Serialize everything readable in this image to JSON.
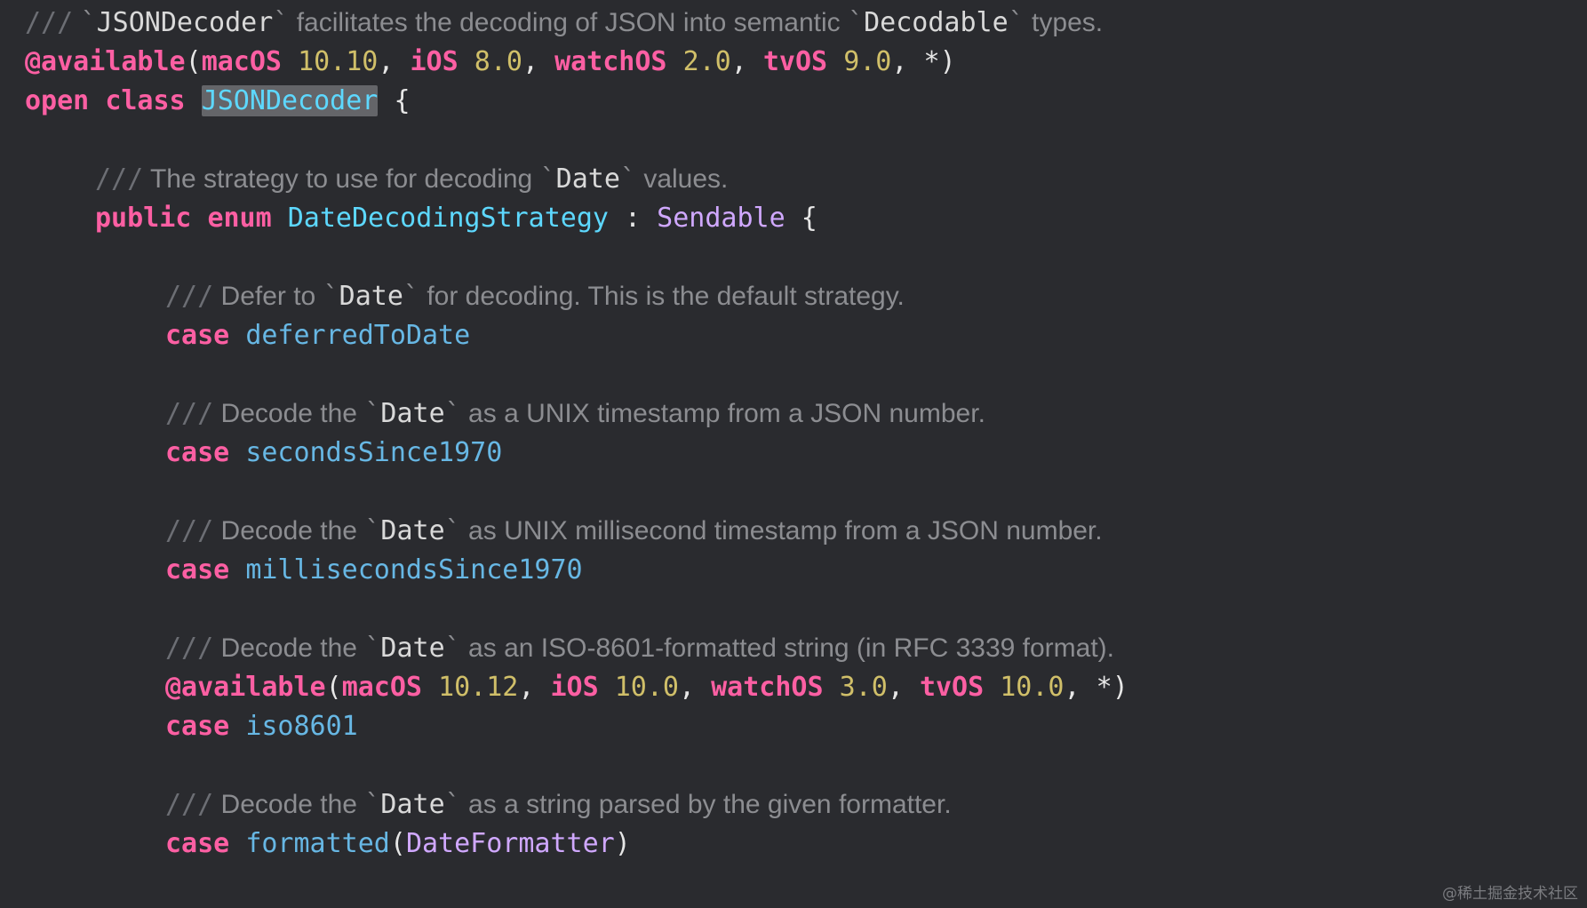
{
  "code": {
    "decoder_doc": {
      "slashes": "///",
      "code1": "JSONDecoder",
      "text1": "facilitates the decoding of JSON into semantic",
      "code2": "Decodable",
      "text2": "types."
    },
    "available1": {
      "attr": "@available",
      "macos": "macOS",
      "macos_ver": "10.10",
      "ios": "iOS",
      "ios_ver": "8.0",
      "watchos": "watchOS",
      "watchos_ver": "2.0",
      "tvos": "tvOS",
      "tvos_ver": "9.0",
      "star": "*"
    },
    "class_decl": {
      "open": "open",
      "class": "class",
      "name": "JSONDecoder",
      "brace": "{"
    },
    "enum_doc": {
      "slashes": "///",
      "text1": "The strategy to use for decoding",
      "code1": "Date",
      "text2": "values."
    },
    "enum_decl": {
      "public": "public",
      "enum": "enum",
      "name": "DateDecodingStrategy",
      "colon": ":",
      "protocol": "Sendable",
      "brace": "{"
    },
    "cases": [
      {
        "doc_slashes": "///",
        "doc_text1": "Defer to",
        "doc_code": "Date",
        "doc_text2": "for decoding. This is the default strategy.",
        "keyword": "case",
        "name": "deferredToDate"
      },
      {
        "doc_slashes": "///",
        "doc_text1": "Decode the",
        "doc_code": "Date",
        "doc_text2": "as a UNIX timestamp from a JSON number.",
        "keyword": "case",
        "name": "secondsSince1970"
      },
      {
        "doc_slashes": "///",
        "doc_text1": "Decode the",
        "doc_code": "Date",
        "doc_text2": "as UNIX millisecond timestamp from a JSON number.",
        "keyword": "case",
        "name": "millisecondsSince1970"
      },
      {
        "doc_slashes": "///",
        "doc_text1": "Decode the",
        "doc_code": "Date",
        "doc_text2": "as an ISO-8601-formatted string (in RFC 3339 format).",
        "keyword": "case",
        "name": "iso8601"
      },
      {
        "doc_slashes": "///",
        "doc_text1": "Decode the",
        "doc_code": "Date",
        "doc_text2": "as a string parsed by the given formatter.",
        "keyword": "case",
        "name": "formatted",
        "param_type": "DateFormatter"
      }
    ],
    "available2": {
      "attr": "@available",
      "macos": "macOS",
      "macos_ver": "10.12",
      "ios": "iOS",
      "ios_ver": "10.0",
      "watchos": "watchOS",
      "watchos_ver": "3.0",
      "tvos": "tvOS",
      "tvos_ver": "10.0",
      "star": "*"
    }
  },
  "watermark": "@稀土掘金技术社区",
  "colors": {
    "background": "#2a2b2f",
    "keyword": "#fc5fa3",
    "number": "#d0bf69",
    "type_declaration": "#5dd8ff",
    "type_reference": "#d0a8ff",
    "case_name": "#67b7e4",
    "comment": "#8c8d91",
    "selection": "#646569"
  }
}
